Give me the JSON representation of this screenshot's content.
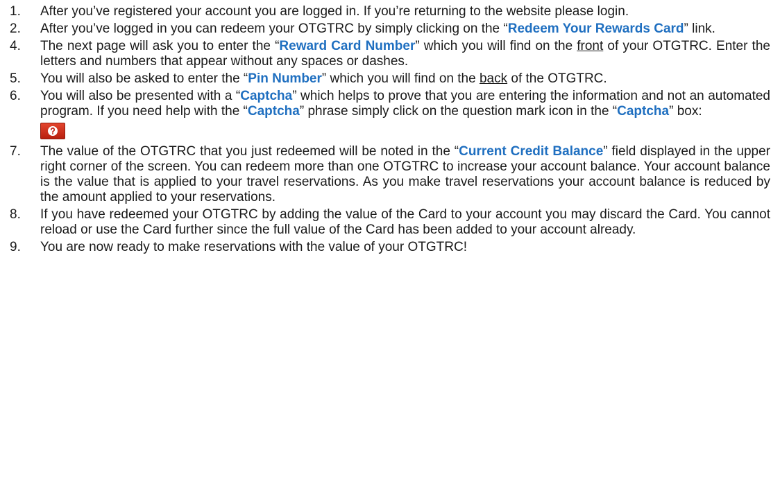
{
  "items": [
    {
      "num": "1.",
      "parts": [
        {
          "t": "After you’ve registered your account you are logged in. If you’re returning to the website please login."
        }
      ]
    },
    {
      "num": "2.",
      "parts": [
        {
          "t": "After you’ve logged in you can redeem your OTGTRC by simply clicking on the “"
        },
        {
          "t": "Redeem Your Rewards Card",
          "style": "kw"
        },
        {
          "t": "” link."
        }
      ]
    },
    {
      "num": "4.",
      "parts": [
        {
          "t": "The next page will ask you to enter the “"
        },
        {
          "t": "Reward Card Number",
          "style": "kw"
        },
        {
          "t": "” which you will find on the "
        },
        {
          "t": "front",
          "style": "u"
        },
        {
          "t": " of your OTGTRC. Enter the letters and numbers that appear without any spaces or dashes."
        }
      ]
    },
    {
      "num": "5.",
      "parts": [
        {
          "t": "You will also be asked to enter the “"
        },
        {
          "t": "Pin Number",
          "style": "kw"
        },
        {
          "t": "” which you will find on the "
        },
        {
          "t": "back",
          "style": "u"
        },
        {
          "t": " of the OTGTRC."
        }
      ]
    },
    {
      "num": "6.",
      "parts": [
        {
          "t": "You will also be presented with a “"
        },
        {
          "t": "Captcha",
          "style": "kw"
        },
        {
          "t": "” which helps to prove that you are entering the information and not an automated program. If you need help with the “"
        },
        {
          "t": "Captcha",
          "style": "kw"
        },
        {
          "t": "” phrase simply click on the question mark icon in the “"
        },
        {
          "t": "Captcha",
          "style": "kw"
        },
        {
          "t": "” box:"
        }
      ],
      "icon": "question-mark-icon"
    },
    {
      "num": "7.",
      "parts": [
        {
          "t": "The value of the OTGTRC that you just redeemed will be noted in the “"
        },
        {
          "t": "Current Credit Balance",
          "style": "kw"
        },
        {
          "t": "” field displayed in the upper right corner of the screen. You can redeem more than one OTGTRC to increase your account balance. Your account balance is the value that is applied to your travel reservations. As you make travel reservations your account balance is reduced by the amount applied to your reservations."
        }
      ]
    },
    {
      "num": "8.",
      "parts": [
        {
          "t": "If you have redeemed your OTGTRC by adding the value of the Card to your account you may discard the Card. You cannot reload or use the Card further since the full value of the Card has been added to your account already."
        }
      ]
    },
    {
      "num": "9.",
      "parts": [
        {
          "t": "You are now ready to make reservations with the value of your OTGTRC!"
        }
      ]
    }
  ],
  "colors": {
    "keyword": "#1f6fc0",
    "icon_background": "#d2321c"
  }
}
